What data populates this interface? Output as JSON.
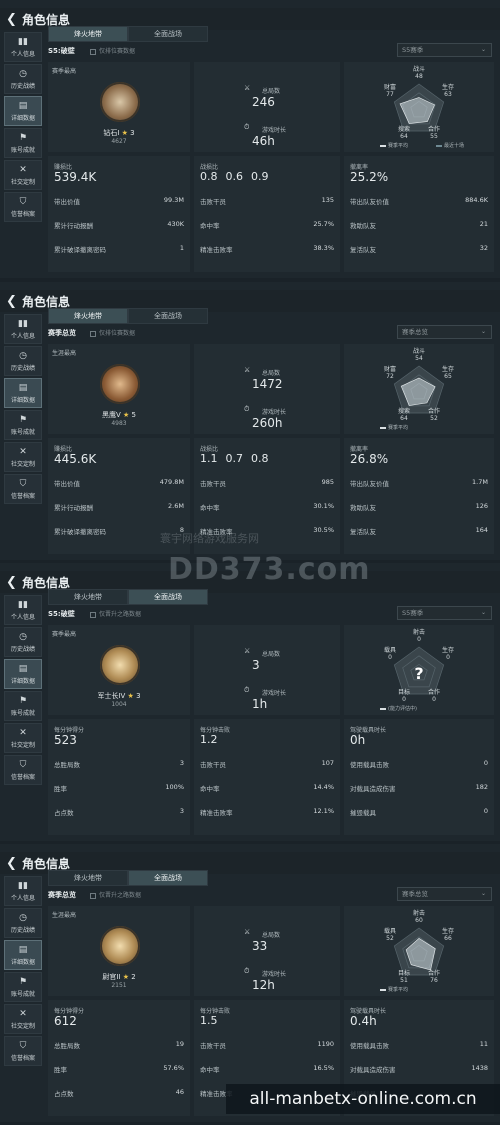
{
  "status_text": "",
  "header_title": "角色信息",
  "sidebar": [
    "个人信息",
    "历史战绩",
    "详细数据",
    "账号成就",
    "社交定制",
    "信誉档案"
  ],
  "tabs": [
    "烽火地带",
    "全面战场"
  ],
  "watermark": {
    "line1": "寰宇网络游戏服务网",
    "line2": "DD373.com"
  },
  "url_overlay": "all-manbetx-online.com.cn",
  "panels": [
    {
      "season": "S5:破壁",
      "checkbox": "仅排位赛数据",
      "select": "S5赛季",
      "caption": "赛季最高",
      "rank": "钻石I",
      "stars": "3",
      "points": "4627",
      "s1_label": "总局数",
      "s1_value": "246",
      "s2_label": "游戏时长",
      "s2_value": "46h",
      "radar": {
        "top_label": "战斗",
        "top": "48",
        "right_label": "生存",
        "right": "63",
        "br_label": "合作",
        "br": "55",
        "bl_label": "搜索",
        "bl": "64",
        "left_label": "财富",
        "left": "77",
        "legend1": "赛季平均",
        "legend2": "最近十场"
      },
      "b1": {
        "label": "赚损比",
        "value": "539.4K",
        "rows": [
          [
            "带出价值",
            "99.3M"
          ],
          [
            "累计行动报酬",
            "430K"
          ],
          [
            "累计破译撤离密码",
            "1"
          ]
        ]
      },
      "b2": {
        "label": "战损比",
        "values": [
          "0.8",
          "0.6",
          "0.9"
        ],
        "rows": [
          [
            "击败干员",
            "135"
          ],
          [
            "命中率",
            "25.7%"
          ],
          [
            "精准击败率",
            "38.3%"
          ]
        ]
      },
      "b3": {
        "label": "撤离率",
        "value": "25.2%",
        "rows": [
          [
            "带出队友价值",
            "884.6K"
          ],
          [
            "救助队友",
            "21"
          ],
          [
            "复活队友",
            "32"
          ]
        ]
      }
    },
    {
      "season": "赛季总览",
      "checkbox": "仅排位赛数据",
      "select": "赛季总览",
      "caption": "生涯最高",
      "rank": "黑鹰V",
      "stars": "5",
      "points": "4983",
      "s1_label": "总局数",
      "s1_value": "1472",
      "s2_label": "游戏时长",
      "s2_value": "260h",
      "radar": {
        "top_label": "战斗",
        "top": "54",
        "right_label": "生存",
        "right": "65",
        "br_label": "合作",
        "br": "52",
        "bl_label": "搜索",
        "bl": "64",
        "left_label": "财富",
        "left": "72",
        "legend1": "赛季平均",
        "legend2": ""
      },
      "b1": {
        "label": "赚损比",
        "value": "445.6K",
        "rows": [
          [
            "带出价值",
            "479.8M"
          ],
          [
            "累计行动报酬",
            "2.6M"
          ],
          [
            "累计破译撤离密码",
            "8"
          ]
        ]
      },
      "b2": {
        "label": "战损比",
        "values": [
          "1.1",
          "0.7",
          "0.8"
        ],
        "rows": [
          [
            "击败干员",
            "985"
          ],
          [
            "命中率",
            "30.1%"
          ],
          [
            "精准击败率",
            "30.5%"
          ]
        ]
      },
      "b3": {
        "label": "撤离率",
        "value": "26.8%",
        "rows": [
          [
            "带出队友价值",
            "1.7M"
          ],
          [
            "救助队友",
            "126"
          ],
          [
            "复活队友",
            "164"
          ]
        ]
      }
    },
    {
      "season": "S5:破壁",
      "checkbox": "仅晋升之路数据",
      "select": "S5赛季",
      "caption": "赛季最高",
      "rank": "军士长IV",
      "stars": "3",
      "points": "1004",
      "s1_label": "总局数",
      "s1_value": "3",
      "s2_label": "游戏时长",
      "s2_value": "1h",
      "radar": {
        "top_label": "射击",
        "top": "0",
        "right_label": "生存",
        "right": "0",
        "br_label": "合作",
        "br": "0",
        "bl_label": "目标",
        "bl": "0",
        "left_label": "载具",
        "left": "0",
        "legend1": "(能力评估中)",
        "legend2": ""
      },
      "b1": {
        "label": "每分钟得分",
        "value": "523",
        "rows": [
          [
            "总胜局数",
            "3"
          ],
          [
            "胜率",
            "100%"
          ],
          [
            "占点数",
            "3"
          ]
        ]
      },
      "b2": {
        "label": "每分钟击败",
        "values": [
          "1.2"
        ],
        "rows": [
          [
            "击败干员",
            "107"
          ],
          [
            "命中率",
            "14.4%"
          ],
          [
            "精准击败率",
            "12.1%"
          ]
        ]
      },
      "b3": {
        "label": "驾驶载具时长",
        "value": "0h",
        "rows": [
          [
            "使用载具击败",
            "0"
          ],
          [
            "对载具造成伤害",
            "182"
          ],
          [
            "摧毁载具",
            "0"
          ]
        ]
      }
    },
    {
      "season": "赛季总览",
      "checkbox": "仅晋升之路数据",
      "select": "赛季总览",
      "caption": "生涯最高",
      "rank": "尉官II",
      "stars": "2",
      "points": "2151",
      "s1_label": "总局数",
      "s1_value": "33",
      "s2_label": "游戏时长",
      "s2_value": "12h",
      "radar": {
        "top_label": "射击",
        "top": "60",
        "right_label": "生存",
        "right": "66",
        "br_label": "合作",
        "br": "76",
        "bl_label": "目标",
        "bl": "51",
        "left_label": "载具",
        "left": "52",
        "legend1": "赛季平均",
        "legend2": ""
      },
      "b1": {
        "label": "每分钟得分",
        "value": "612",
        "rows": [
          [
            "总胜局数",
            "19"
          ],
          [
            "胜率",
            "57.6%"
          ],
          [
            "占点数",
            "46"
          ]
        ]
      },
      "b2": {
        "label": "每分钟击败",
        "values": [
          "1.5"
        ],
        "rows": [
          [
            "击败干员",
            "1190"
          ],
          [
            "命中率",
            "16.5%"
          ],
          [
            "精准击败率",
            ""
          ]
        ]
      },
      "b3": {
        "label": "驾驶载具时长",
        "value": "0.4h",
        "rows": [
          [
            "使用载具击败",
            "11"
          ],
          [
            "对载具造成伤害",
            "1438"
          ],
          [
            "摧毁载具",
            ""
          ]
        ]
      }
    }
  ]
}
